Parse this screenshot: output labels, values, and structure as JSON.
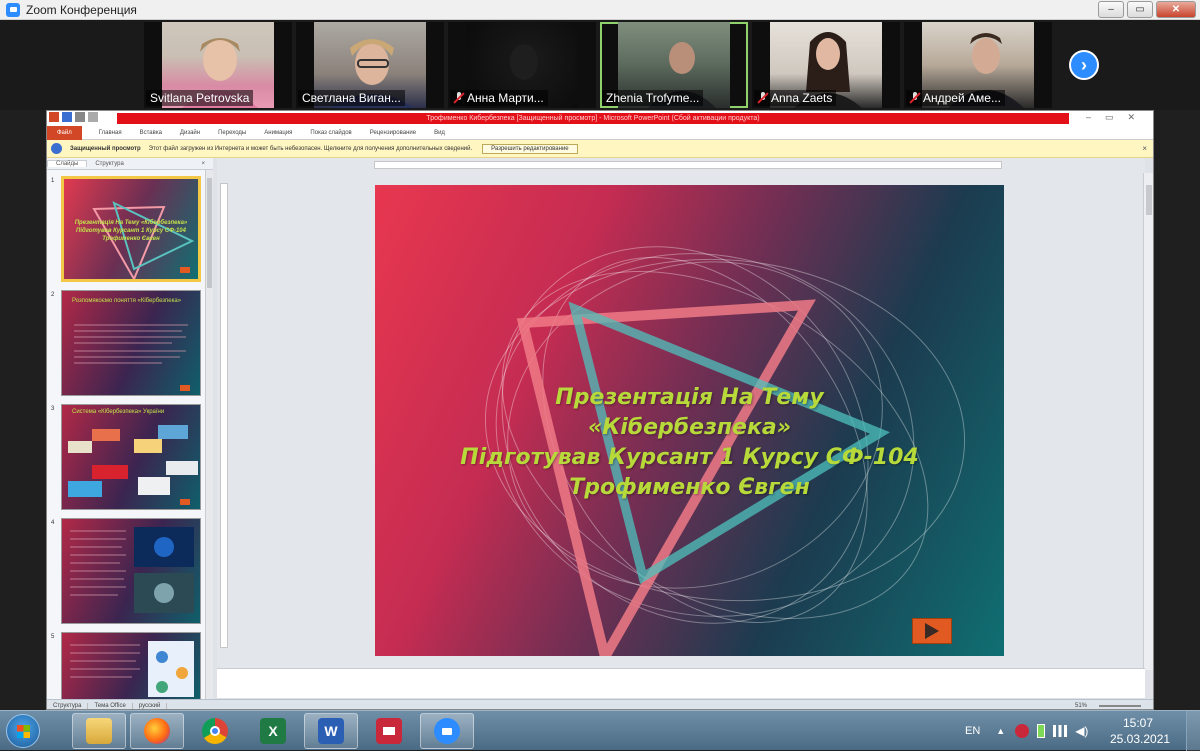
{
  "window": {
    "title": "Zoom Конференция",
    "controls": [
      "–",
      "▭",
      "✕"
    ]
  },
  "participants": [
    {
      "name": "Svitlana Petrovska",
      "muted": false,
      "active": false
    },
    {
      "name": "Светлана Виган...",
      "muted": false,
      "active": false
    },
    {
      "name": "Анна Марти...",
      "muted": true,
      "active": false
    },
    {
      "name": "Zhenia Trofyme...",
      "muted": false,
      "active": true
    },
    {
      "name": "Anna Zaets",
      "muted": true,
      "active": false
    },
    {
      "name": "Андрей Аме...",
      "muted": true,
      "active": false
    }
  ],
  "next_label": "›",
  "powerpoint": {
    "title": "Трофименко Кибербезпека [Защищенный просмотр] - Microsoft PowerPoint (Сбой активации продукта)",
    "tabs": [
      "Файл",
      "Главная",
      "Вставка",
      "Дизайн",
      "Переходы",
      "Анимация",
      "Показ слайдов",
      "Рецензирование",
      "Вид"
    ],
    "message": {
      "title": "Защищенный просмотр",
      "text": "Этот файл загружен из Интернета и может быть небезопасен. Щелкните для получения дополнительных сведений.",
      "button": "Разрешить редактирование",
      "close": "×"
    },
    "pane_tabs": [
      "Слайды",
      "Структура",
      "×"
    ],
    "slide_numbers": [
      "1",
      "2",
      "3",
      "4",
      "5"
    ],
    "slide": {
      "line1": "Презентація На Тему",
      "line2": "«Кібербезпека»",
      "line3": "Підготував Курсант 1 Курсу СФ-104",
      "line4": "Трофименко Євген"
    },
    "thumbs": [
      {
        "lines": [
          "Презентація На Тему «Кібербезпека»",
          "Підготував Курсант 1 Курсу СФ-104",
          "Трофименко Євген"
        ]
      },
      {
        "title": "Розпомякоємо поняття «Кібербезпека»"
      },
      {
        "title": "Система «Кібербезпека» України"
      },
      {
        "title": ""
      },
      {
        "title": ""
      }
    ],
    "status": {
      "left": [
        "Структура",
        "Тема Office",
        "русский"
      ],
      "zoom": "51%"
    }
  },
  "taskbar": {
    "apps": [
      "explorer",
      "firefox",
      "chrome",
      "excel",
      "word",
      "save",
      "zoom"
    ],
    "lang": "EN",
    "time": "15:07",
    "date": "25.03.2021"
  },
  "colors": {
    "slide_text": "#b7d93a",
    "zoom_blue": "#2d8cff",
    "ppt_red": "#e3101a"
  }
}
